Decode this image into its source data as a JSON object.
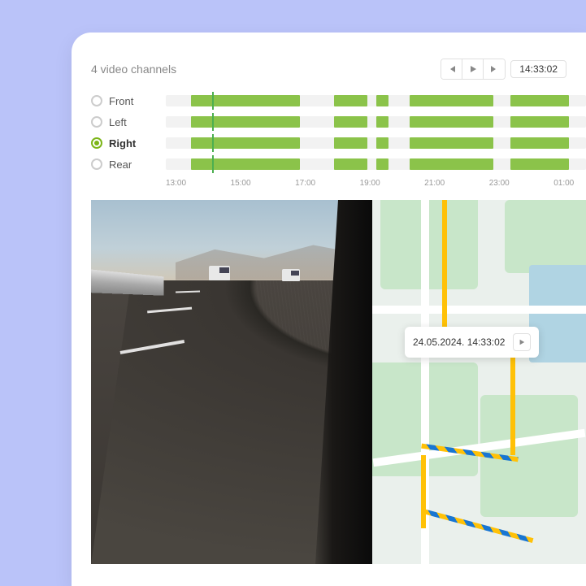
{
  "header": {
    "title": "4 video channels",
    "time": "14:33:02"
  },
  "channels": [
    {
      "name": "Front",
      "selected": false,
      "segments": [
        [
          6,
          26
        ],
        [
          40,
          8
        ],
        [
          50,
          3
        ],
        [
          58,
          20
        ],
        [
          82,
          14
        ]
      ]
    },
    {
      "name": "Left",
      "selected": false,
      "segments": [
        [
          6,
          26
        ],
        [
          40,
          8
        ],
        [
          50,
          3
        ],
        [
          58,
          20
        ],
        [
          82,
          14
        ]
      ]
    },
    {
      "name": "Right",
      "selected": true,
      "segments": [
        [
          6,
          26
        ],
        [
          40,
          8
        ],
        [
          50,
          3
        ],
        [
          58,
          20
        ],
        [
          82,
          14
        ]
      ]
    },
    {
      "name": "Rear",
      "selected": false,
      "segments": [
        [
          6,
          26
        ],
        [
          40,
          8
        ],
        [
          50,
          3
        ],
        [
          58,
          20
        ],
        [
          82,
          14
        ]
      ]
    }
  ],
  "playhead_pct": 11,
  "time_axis": [
    "13:00",
    "15:00",
    "17:00",
    "19:00",
    "21:00",
    "23:00",
    "01:00"
  ],
  "tooltip": {
    "text": "24.05.2024. 14:33:02"
  },
  "colors": {
    "accent": "#8BC34A",
    "route_a": "#FFC107",
    "route_b": "#1976D2"
  }
}
